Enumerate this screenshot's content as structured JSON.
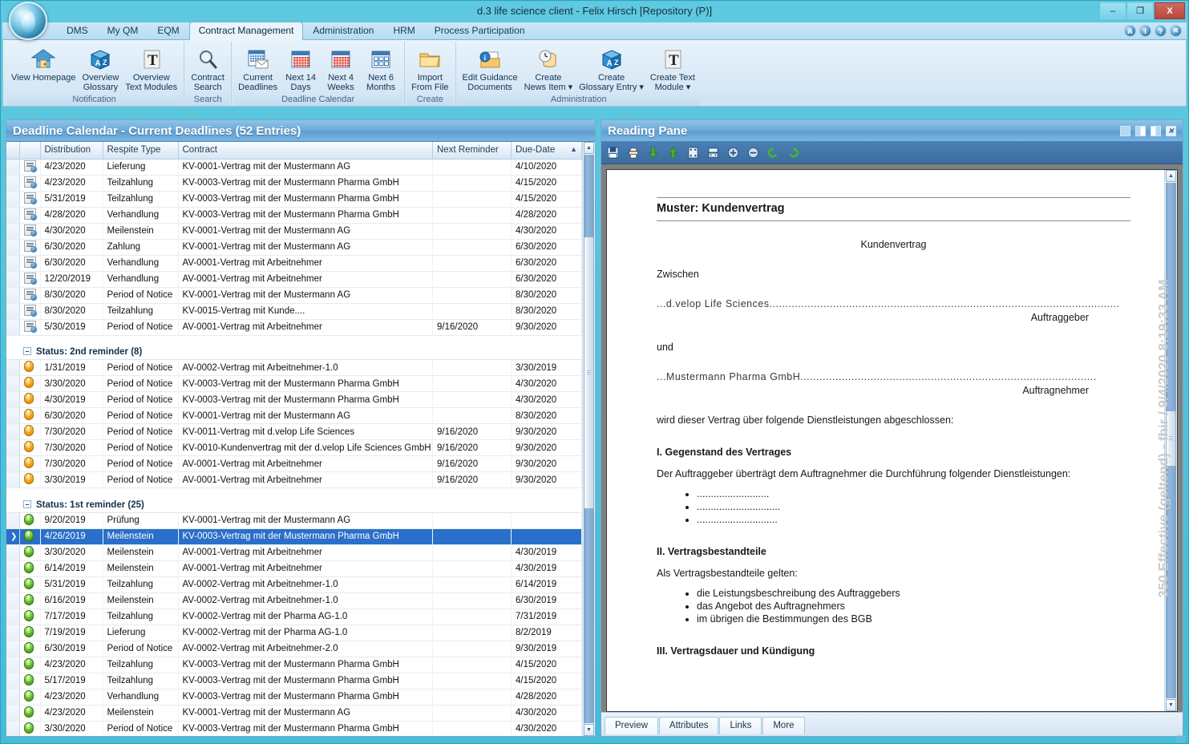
{
  "window": {
    "title": "d.3 life science client - Felix Hirsch [Repository (P)]",
    "minimize": "–",
    "maximize": "❐",
    "close": "X"
  },
  "top_icons": [
    {
      "name": "accessibility-icon",
      "glyph": "A"
    },
    {
      "name": "info-icon",
      "glyph": "i"
    },
    {
      "name": "help-icon",
      "glyph": "?"
    },
    {
      "name": "close-session-icon",
      "glyph": "✕"
    }
  ],
  "tabs": [
    {
      "label": "DMS",
      "active": false
    },
    {
      "label": "My QM",
      "active": false
    },
    {
      "label": "EQM",
      "active": false
    },
    {
      "label": "Contract Management",
      "active": true
    },
    {
      "label": "Administration",
      "active": false
    },
    {
      "label": "HRM",
      "active": false
    },
    {
      "label": "Process Participation",
      "active": false
    }
  ],
  "ribbon": {
    "groups": [
      {
        "label": "Notification",
        "items": [
          {
            "label": "View Homepage",
            "icon": "home-icon"
          },
          {
            "label": "Overview\nGlossary",
            "icon": "az-cube-icon"
          },
          {
            "label": "Overview\nText Modules",
            "icon": "text-module-icon"
          }
        ]
      },
      {
        "label": "Search",
        "items": [
          {
            "label": "Contract\nSearch",
            "icon": "magnifier-icon"
          }
        ]
      },
      {
        "label": "Deadline Calendar",
        "items": [
          {
            "label": "Current\nDeadlines",
            "icon": "calendar-envelope-icon"
          },
          {
            "label": "Next 14\nDays",
            "icon": "calendar-icon"
          },
          {
            "label": "Next 4\nWeeks",
            "icon": "calendar-icon"
          },
          {
            "label": "Next 6\nMonths",
            "icon": "calendar-months-icon"
          }
        ]
      },
      {
        "label": "Create",
        "items": [
          {
            "label": "Import\nFrom File",
            "icon": "folder-import-icon"
          }
        ]
      },
      {
        "label": "Administration",
        "items": [
          {
            "label": "Edit Guidance\nDocuments",
            "icon": "info-folder-icon"
          },
          {
            "label": "Create\nNews Item ▾",
            "icon": "news-clock-icon"
          },
          {
            "label": "Create\nGlossary Entry ▾",
            "icon": "az-cube-icon"
          },
          {
            "label": "Create Text\nModule ▾",
            "icon": "text-module-icon"
          }
        ]
      }
    ]
  },
  "left_panel": {
    "title": "Deadline Calendar - Current Deadlines  (52 Entries)",
    "columns": [
      "Distribution",
      "Respite Type",
      "Contract",
      "Next Reminder",
      "Due-Date"
    ],
    "sort_column": "Due-Date",
    "sort_glyph": "▲",
    "rows": [
      {
        "type": "row",
        "icon": "document-icon",
        "distribution": "4/23/2020",
        "respite": "Lieferung",
        "contract": "KV-0001-Vertrag mit der Mustermann AG",
        "reminder": "",
        "due": "4/10/2020"
      },
      {
        "type": "row",
        "icon": "document-icon",
        "distribution": "4/23/2020",
        "respite": "Teilzahlung",
        "contract": "KV-0003-Vertrag mit der Mustermann Pharma GmbH",
        "reminder": "",
        "due": "4/15/2020"
      },
      {
        "type": "row",
        "icon": "document-icon",
        "distribution": "5/31/2019",
        "respite": "Teilzahlung",
        "contract": "KV-0003-Vertrag mit der Mustermann Pharma GmbH",
        "reminder": "",
        "due": "4/15/2020"
      },
      {
        "type": "row",
        "icon": "document-icon",
        "distribution": "4/28/2020",
        "respite": "Verhandlung",
        "contract": "KV-0003-Vertrag mit der Mustermann Pharma GmbH",
        "reminder": "",
        "due": "4/28/2020"
      },
      {
        "type": "row",
        "icon": "document-icon",
        "distribution": "4/30/2020",
        "respite": "Meilenstein",
        "contract": "KV-0001-Vertrag mit der Mustermann AG",
        "reminder": "",
        "due": "4/30/2020"
      },
      {
        "type": "row",
        "icon": "document-icon",
        "distribution": "6/30/2020",
        "respite": "Zahlung",
        "contract": "KV-0001-Vertrag mit der Mustermann AG",
        "reminder": "",
        "due": "6/30/2020"
      },
      {
        "type": "row",
        "icon": "document-icon",
        "distribution": "6/30/2020",
        "respite": "Verhandlung",
        "contract": "AV-0001-Vertrag mit Arbeitnehmer",
        "reminder": "",
        "due": "6/30/2020"
      },
      {
        "type": "row",
        "icon": "document-icon",
        "distribution": "12/20/2019",
        "respite": "Verhandlung",
        "contract": "AV-0001-Vertrag mit Arbeitnehmer",
        "reminder": "",
        "due": "6/30/2020"
      },
      {
        "type": "row",
        "icon": "document-icon",
        "distribution": "8/30/2020",
        "respite": "Period of Notice",
        "contract": "KV-0001-Vertrag mit der Mustermann AG",
        "reminder": "",
        "due": "8/30/2020"
      },
      {
        "type": "row",
        "icon": "document-icon",
        "distribution": "8/30/2020",
        "respite": "Teilzahlung",
        "contract": "KV-0015-Vertrag mit Kunde....",
        "reminder": "",
        "due": "8/30/2020"
      },
      {
        "type": "row",
        "icon": "document-icon",
        "distribution": "5/30/2019",
        "respite": "Period of Notice",
        "contract": "AV-0001-Vertrag mit Arbeitnehmer",
        "reminder": "9/16/2020",
        "due": "9/30/2020"
      },
      {
        "type": "spacer"
      },
      {
        "type": "group",
        "label": "Status: 2nd reminder (8)"
      },
      {
        "type": "row",
        "icon": "orange-alert-icon",
        "distribution": "1/31/2019",
        "respite": "Period of Notice",
        "contract": "AV-0002-Vertrag mit Arbeitnehmer-1.0",
        "reminder": "",
        "due": "3/30/2019"
      },
      {
        "type": "row",
        "icon": "orange-alert-icon",
        "distribution": "3/30/2020",
        "respite": "Period of Notice",
        "contract": "KV-0003-Vertrag mit der Mustermann Pharma GmbH",
        "reminder": "",
        "due": "4/30/2020"
      },
      {
        "type": "row",
        "icon": "orange-alert-icon",
        "distribution": "4/30/2019",
        "respite": "Period of Notice",
        "contract": "KV-0003-Vertrag mit der Mustermann Pharma GmbH",
        "reminder": "",
        "due": "4/30/2020"
      },
      {
        "type": "row",
        "icon": "orange-alert-icon",
        "distribution": "6/30/2020",
        "respite": "Period of Notice",
        "contract": "KV-0001-Vertrag mit der Mustermann AG",
        "reminder": "",
        "due": "8/30/2020"
      },
      {
        "type": "row",
        "icon": "orange-alert-icon",
        "distribution": "7/30/2020",
        "respite": "Period of Notice",
        "contract": "KV-0011-Vertrag mit d.velop Life Sciences",
        "reminder": "9/16/2020",
        "due": "9/30/2020"
      },
      {
        "type": "row",
        "icon": "orange-alert-icon",
        "distribution": "7/30/2020",
        "respite": "Period of Notice",
        "contract": "KV-0010-Kundenvertrag mit der d.velop Life Sciences GmbH",
        "reminder": "9/16/2020",
        "due": "9/30/2020"
      },
      {
        "type": "row",
        "icon": "orange-alert-icon",
        "distribution": "7/30/2020",
        "respite": "Period of Notice",
        "contract": "AV-0001-Vertrag mit Arbeitnehmer",
        "reminder": "9/16/2020",
        "due": "9/30/2020"
      },
      {
        "type": "row",
        "icon": "orange-alert-icon",
        "distribution": "3/30/2019",
        "respite": "Period of Notice",
        "contract": "AV-0001-Vertrag mit Arbeitnehmer",
        "reminder": "9/16/2020",
        "due": "9/30/2020"
      },
      {
        "type": "spacer"
      },
      {
        "type": "group",
        "label": "Status: 1st reminder (25)"
      },
      {
        "type": "row",
        "icon": "green-alert-icon",
        "distribution": "9/20/2019",
        "respite": "Prüfung",
        "contract": "KV-0001-Vertrag mit der Mustermann AG",
        "reminder": "",
        "due": ""
      },
      {
        "type": "row",
        "icon": "green-alert-icon",
        "selected": true,
        "distribution": "4/26/2019",
        "respite": "Meilenstein",
        "contract": "KV-0003-Vertrag mit der Mustermann Pharma GmbH",
        "reminder": "",
        "due": ""
      },
      {
        "type": "row",
        "icon": "green-alert-icon",
        "distribution": "3/30/2020",
        "respite": "Meilenstein",
        "contract": "AV-0001-Vertrag mit Arbeitnehmer",
        "reminder": "",
        "due": "4/30/2019"
      },
      {
        "type": "row",
        "icon": "green-alert-icon",
        "distribution": "6/14/2019",
        "respite": "Meilenstein",
        "contract": "AV-0001-Vertrag mit Arbeitnehmer",
        "reminder": "",
        "due": "4/30/2019"
      },
      {
        "type": "row",
        "icon": "green-alert-icon",
        "distribution": "5/31/2019",
        "respite": "Teilzahlung",
        "contract": "AV-0002-Vertrag mit Arbeitnehmer-1.0",
        "reminder": "",
        "due": "6/14/2019"
      },
      {
        "type": "row",
        "icon": "green-alert-icon",
        "distribution": "6/16/2019",
        "respite": "Meilenstein",
        "contract": "AV-0002-Vertrag mit Arbeitnehmer-1.0",
        "reminder": "",
        "due": "6/30/2019"
      },
      {
        "type": "row",
        "icon": "green-alert-icon",
        "distribution": "7/17/2019",
        "respite": "Teilzahlung",
        "contract": "KV-0002-Vertrag mit der Pharma AG-1.0",
        "reminder": "",
        "due": "7/31/2019"
      },
      {
        "type": "row",
        "icon": "green-alert-icon",
        "distribution": "7/19/2019",
        "respite": "Lieferung",
        "contract": "KV-0002-Vertrag mit der Pharma AG-1.0",
        "reminder": "",
        "due": "8/2/2019"
      },
      {
        "type": "row",
        "icon": "green-alert-icon",
        "distribution": "6/30/2019",
        "respite": "Period of Notice",
        "contract": "AV-0002-Vertrag mit Arbeitnehmer-2.0",
        "reminder": "",
        "due": "9/30/2019"
      },
      {
        "type": "row",
        "icon": "green-alert-icon",
        "distribution": "4/23/2020",
        "respite": "Teilzahlung",
        "contract": "KV-0003-Vertrag mit der Mustermann Pharma GmbH",
        "reminder": "",
        "due": "4/15/2020"
      },
      {
        "type": "row",
        "icon": "green-alert-icon",
        "distribution": "5/17/2019",
        "respite": "Teilzahlung",
        "contract": "KV-0003-Vertrag mit der Mustermann Pharma GmbH",
        "reminder": "",
        "due": "4/15/2020"
      },
      {
        "type": "row",
        "icon": "green-alert-icon",
        "distribution": "4/23/2020",
        "respite": "Verhandlung",
        "contract": "KV-0003-Vertrag mit der Mustermann Pharma GmbH",
        "reminder": "",
        "due": "4/28/2020"
      },
      {
        "type": "row",
        "icon": "green-alert-icon",
        "distribution": "4/23/2020",
        "respite": "Meilenstein",
        "contract": "KV-0001-Vertrag mit der Mustermann AG",
        "reminder": "",
        "due": "4/30/2020"
      },
      {
        "type": "row",
        "icon": "green-alert-icon",
        "distribution": "3/30/2020",
        "respite": "Period of Notice",
        "contract": "KV-0003-Vertrag mit der Mustermann Pharma GmbH",
        "reminder": "",
        "due": "4/30/2020"
      }
    ]
  },
  "right_panel": {
    "title": "Reading Pane",
    "header_buttons": [
      "restore-icon",
      "split-left-icon",
      "split-right-icon",
      "close-icon"
    ],
    "toolbar": [
      {
        "name": "save-icon",
        "glyph": "💾"
      },
      {
        "name": "print-icon",
        "glyph": "🖨"
      },
      {
        "name": "page-down-icon",
        "glyph": "⬇"
      },
      {
        "name": "page-up-icon",
        "glyph": "⬆"
      },
      {
        "name": "fit-page-icon",
        "glyph": "⛶"
      },
      {
        "name": "fit-width-icon",
        "glyph": "▤"
      },
      {
        "name": "zoom-in-icon",
        "glyph": "⊕"
      },
      {
        "name": "zoom-out-icon",
        "glyph": "⊖"
      },
      {
        "name": "rotate-left-icon",
        "glyph": "↺"
      },
      {
        "name": "rotate-right-icon",
        "glyph": "↻"
      }
    ],
    "watermark": "350 Effective (geltend) - fhir / 9/4/2020 8:19:33 AM",
    "document": {
      "title": "Muster: Kundenvertrag",
      "heading_center": "Kundenvertrag",
      "between_label": "Zwischen",
      "party1": "...d.velop Life Sciences..............................................................................................................",
      "party1_role": "Auftraggeber",
      "and_label": "und",
      "party2": "...Mustermann Pharma GmbH.............................................................................................",
      "party2_role": "Auftragnehmer",
      "intro": "wird dieser Vertrag über folgende Dienstleistungen abgeschlossen:",
      "section1_title": "I. Gegenstand des Vertrages",
      "section1_text": "Der Auftraggeber überträgt dem Auftragnehmer die Durchführung folgender Dienstleistungen:",
      "section1_items": [
        "..........................",
        "..............................",
        "............................."
      ],
      "section2_title": "II. Vertragsbestandteile",
      "section2_text": "Als Vertragsbestandteile gelten:",
      "section2_items": [
        "die Leistungsbeschreibung des Auftraggebers",
        "das Angebot des Auftragnehmers",
        "im übrigen die Bestimmungen des BGB"
      ],
      "section3_title": "III. Vertragsdauer und Kündigung"
    },
    "bottom_tabs": [
      {
        "label": "Preview",
        "active": true
      },
      {
        "label": "Attributes",
        "active": false
      },
      {
        "label": "Links",
        "active": false
      },
      {
        "label": "More",
        "active": false
      }
    ]
  },
  "colors": {
    "frame": "#4ec3dd",
    "panel_header": "#6da9d8",
    "selection": "#2a6fc9",
    "ribbon_bg": "#dbeaf7"
  }
}
